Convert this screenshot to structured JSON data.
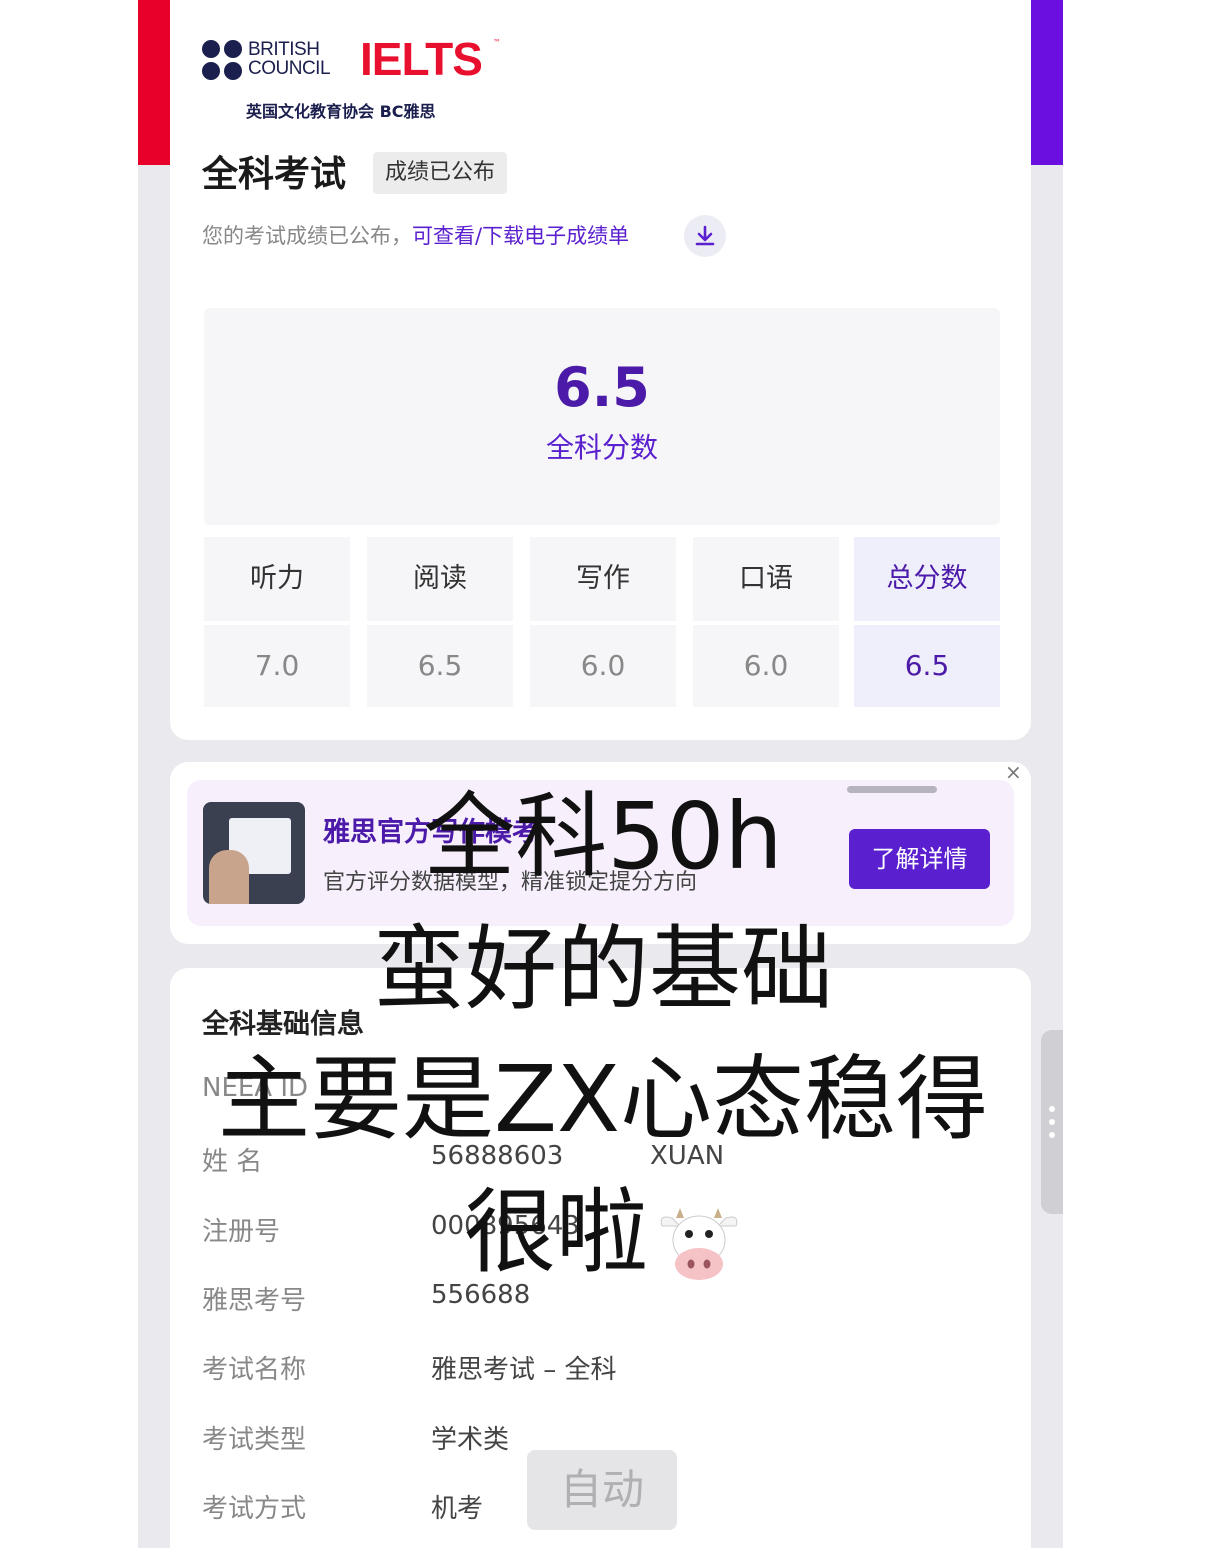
{
  "brand": {
    "bc_line1": "BRITISH",
    "bc_line2": "COUNCIL",
    "ielts": "IELTS",
    "tm": "™",
    "subtitle": "英国文化教育协会 BC雅思"
  },
  "result": {
    "exam_title": "全科考试",
    "status_badge": "成绩已公布",
    "notice_text": "您的考试成绩已公布，",
    "notice_link": "可查看/下载电子成绩单",
    "overall_score": "6.5",
    "overall_label": "全科分数",
    "scores": [
      {
        "label": "听力",
        "value": "7.0"
      },
      {
        "label": "阅读",
        "value": "6.5"
      },
      {
        "label": "写作",
        "value": "6.0"
      },
      {
        "label": "口语",
        "value": "6.0"
      },
      {
        "label": "总分数",
        "value": "6.5"
      }
    ]
  },
  "ad": {
    "title": "雅思官方写作模考",
    "subtitle": "官方评分数据模型，精准锁定提分方向",
    "button": "了解详情",
    "close": "×"
  },
  "info": {
    "title": "全科基础信息",
    "rows": [
      {
        "label": "NEEA ID",
        "value": "",
        "value2": ""
      },
      {
        "label": "姓 名",
        "value": "56888603",
        "value2": "XUAN"
      },
      {
        "label": "注册号",
        "value": "000895643",
        "value2": ""
      },
      {
        "label": "雅思考号",
        "value": "556688",
        "value2": ""
      },
      {
        "label": "考试名称",
        "value": "雅思考试 – 全科",
        "value2": ""
      },
      {
        "label": "考试类型",
        "value": "学术类",
        "value2": ""
      },
      {
        "label": "考试方式",
        "value": "机考",
        "value2": ""
      }
    ]
  },
  "auto_button": "自动",
  "caption": {
    "line1": "全科50h",
    "line2": "蛮好的基础",
    "line3": "主要是ZX心态稳得",
    "line4": "很啦"
  },
  "colors": {
    "brand_red": "#e8102e",
    "accent_purple": "#5a1fcf",
    "score_purple": "#4b1aa8",
    "stripe_left": "#e8002a",
    "stripe_right": "#6a0fe0"
  },
  "icons": [
    "download-icon",
    "close-icon",
    "cow-face-icon",
    "more-dots-icon"
  ]
}
